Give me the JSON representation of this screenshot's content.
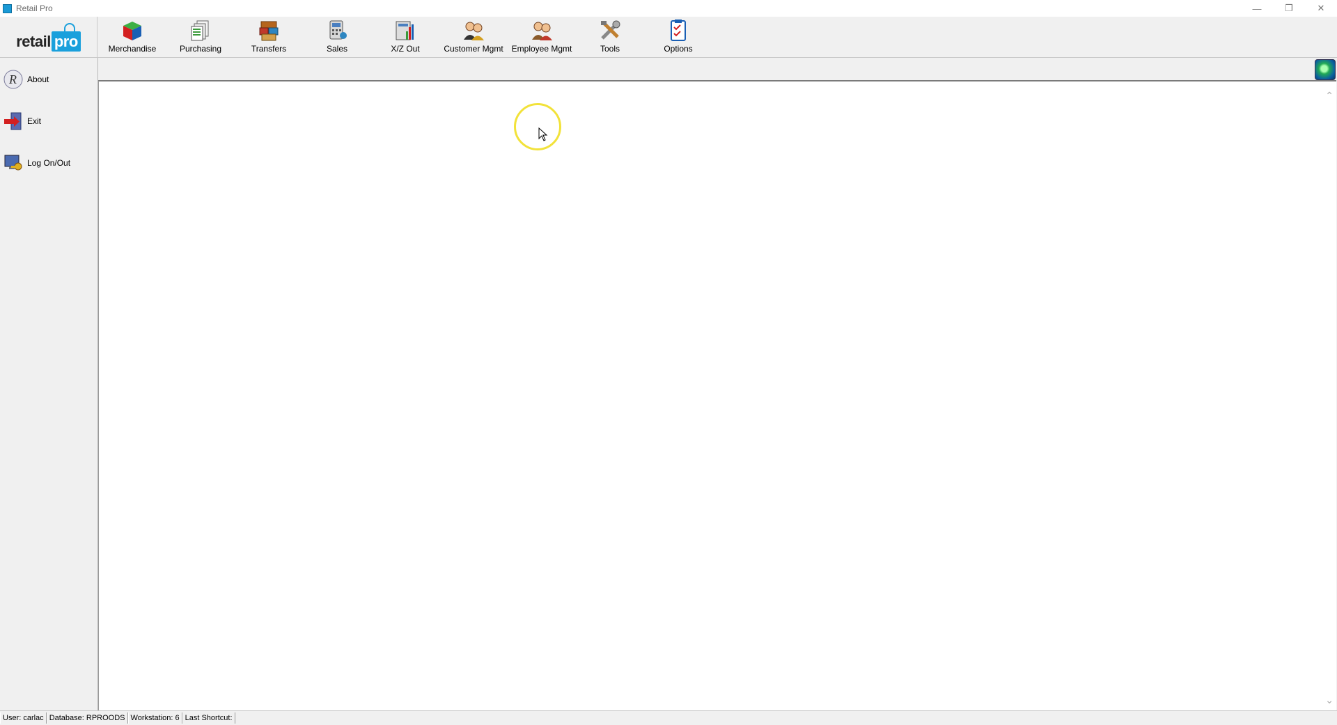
{
  "window": {
    "title": "Retail Pro",
    "controls": [
      "minimize-icon",
      "restore-icon",
      "close-icon"
    ]
  },
  "logo": {
    "text_left": "retail",
    "text_right": "pro"
  },
  "toolbar": {
    "items": [
      {
        "label": "Merchandise",
        "icon": "merchandise-icon"
      },
      {
        "label": "Purchasing",
        "icon": "purchasing-icon"
      },
      {
        "label": "Transfers",
        "icon": "transfers-icon"
      },
      {
        "label": "Sales",
        "icon": "sales-icon"
      },
      {
        "label": "X/Z Out",
        "icon": "xz-out-icon"
      },
      {
        "label": "Customer Mgmt",
        "icon": "customer-mgmt-icon"
      },
      {
        "label": "Employee Mgmt",
        "icon": "employee-mgmt-icon"
      },
      {
        "label": "Tools",
        "icon": "tools-icon"
      },
      {
        "label": "Options",
        "icon": "options-icon"
      }
    ]
  },
  "sidebar": {
    "items": [
      {
        "label": "About",
        "icon": "about-icon"
      },
      {
        "label": "Exit",
        "icon": "exit-icon"
      },
      {
        "label": "Log On/Out",
        "icon": "logon-icon"
      }
    ]
  },
  "status": {
    "user": "User: carlac",
    "database": "Database: RPROODS",
    "workstation": "Workstation: 6",
    "last_shortcut": "Last Shortcut:"
  },
  "colors": {
    "accent": "#1aa0dc",
    "cursor_highlight": "#f2e23a"
  }
}
